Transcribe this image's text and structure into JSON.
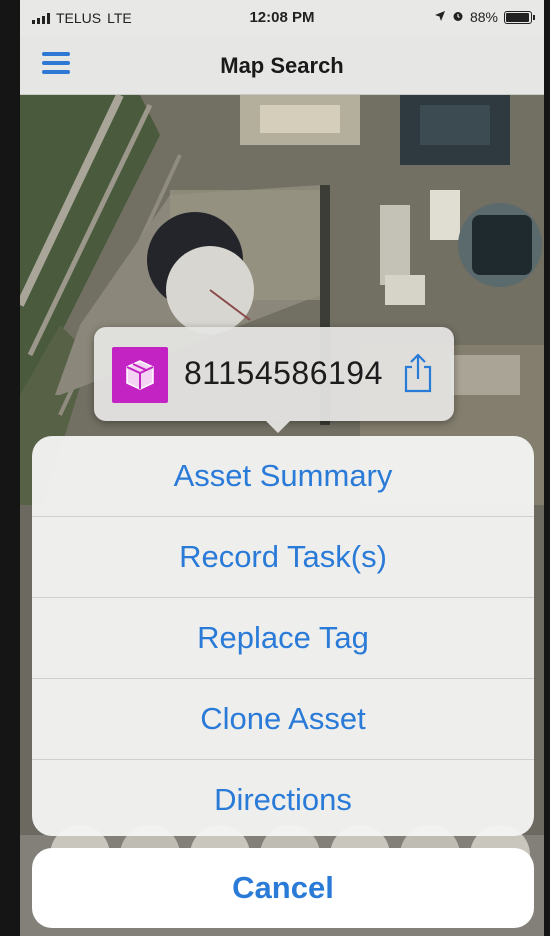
{
  "status_bar": {
    "carrier": "TELUS",
    "network": "LTE",
    "time": "12:08 PM",
    "battery_text": "88%",
    "battery_level": 0.88,
    "icons": [
      "signal-icon",
      "location-arrow-icon",
      "alarm-icon",
      "battery-icon"
    ]
  },
  "nav": {
    "title": "Map Search",
    "menu_icon": "hamburger-menu-icon"
  },
  "callout": {
    "asset_id": "81154586194",
    "asset_icon": "package-box-icon",
    "share_icon": "share-icon"
  },
  "action_sheet": {
    "items": [
      {
        "label": "Asset Summary"
      },
      {
        "label": "Record Task(s)"
      },
      {
        "label": "Replace Tag"
      },
      {
        "label": "Clone Asset"
      },
      {
        "label": "Directions"
      }
    ],
    "cancel_label": "Cancel"
  },
  "colors": {
    "accent": "#2a7bd8",
    "asset_badge": "#c323c3",
    "bar_background": "#e6e6e4"
  }
}
